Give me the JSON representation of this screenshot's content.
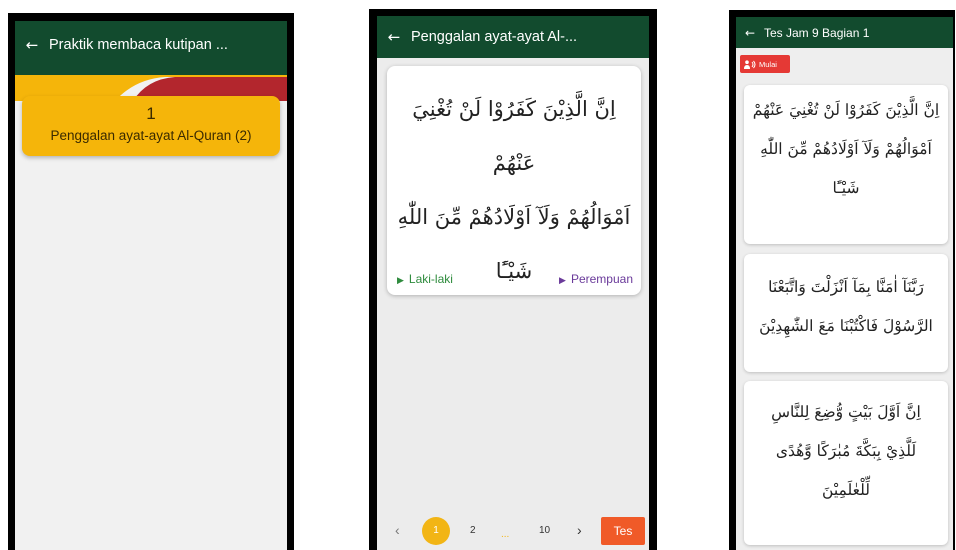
{
  "screen1": {
    "back_icon": "arrow-left-icon",
    "title": "Praktik membaca kutipan ...",
    "card": {
      "number": "1",
      "name": "Penggalan ayat-ayat Al-Quran (2)"
    },
    "colors": {
      "appbar": "#124b2e",
      "card": "#f5b50a",
      "deco_red": "#b3262d",
      "deco_yellow": "#f5b50a"
    }
  },
  "screen2": {
    "back_icon": "arrow-left-icon",
    "title": "Penggalan ayat-ayat Al-...",
    "verse": {
      "lines": [
        "اِنَّ الَّذِيْنَ كَفَرُوْا لَنْ تُغْنِيَ عَنْهُمْ",
        "اَمْوَالُهُمْ وَلَآ اَوْلَادُهُمْ مِّنَ اللّٰهِ",
        "شَيْـًٔا"
      ],
      "audio_male_label": "Laki-laki",
      "audio_female_label": "Perempuan"
    },
    "pagination": {
      "prev_icon": "chevron-left-icon",
      "pages": [
        "1",
        "2",
        "...",
        "10"
      ],
      "current": "1",
      "next_icon": "chevron-right-icon",
      "test_label": "Tes"
    }
  },
  "screen3": {
    "back_icon": "arrow-left-icon",
    "title": "Tes Jam 9 Bagian 1",
    "start_button": {
      "icon": "speaker-person-icon",
      "label": "Mulai"
    },
    "verses": [
      {
        "lines": [
          "اِنَّ الَّذِيْنَ كَفَرُوْا لَنْ تُغْنِيَ عَنْهُمْ",
          "اَمْوَالُهُمْ وَلَآ اَوْلَادُهُمْ مِّنَ اللّٰهِ",
          "شَيْـًٔا"
        ]
      },
      {
        "lines": [
          "رَبَّنَآ اٰمَنَّا بِمَآ اَنْزَلْتَ وَاتَّبَعْنَا",
          "الرَّسُوْلَ فَاكْتُبْنَا مَعَ الشّٰهِدِيْنَ"
        ]
      },
      {
        "lines": [
          "اِنَّ اَوَّلَ بَيْتٍ وُّضِعَ لِلنَّاسِ",
          "لَلَّذِيْ بِبَكَّةَ مُبٰرَكًا وَّهُدًى",
          "لِّلْعٰلَمِيْنَ"
        ]
      }
    ]
  }
}
